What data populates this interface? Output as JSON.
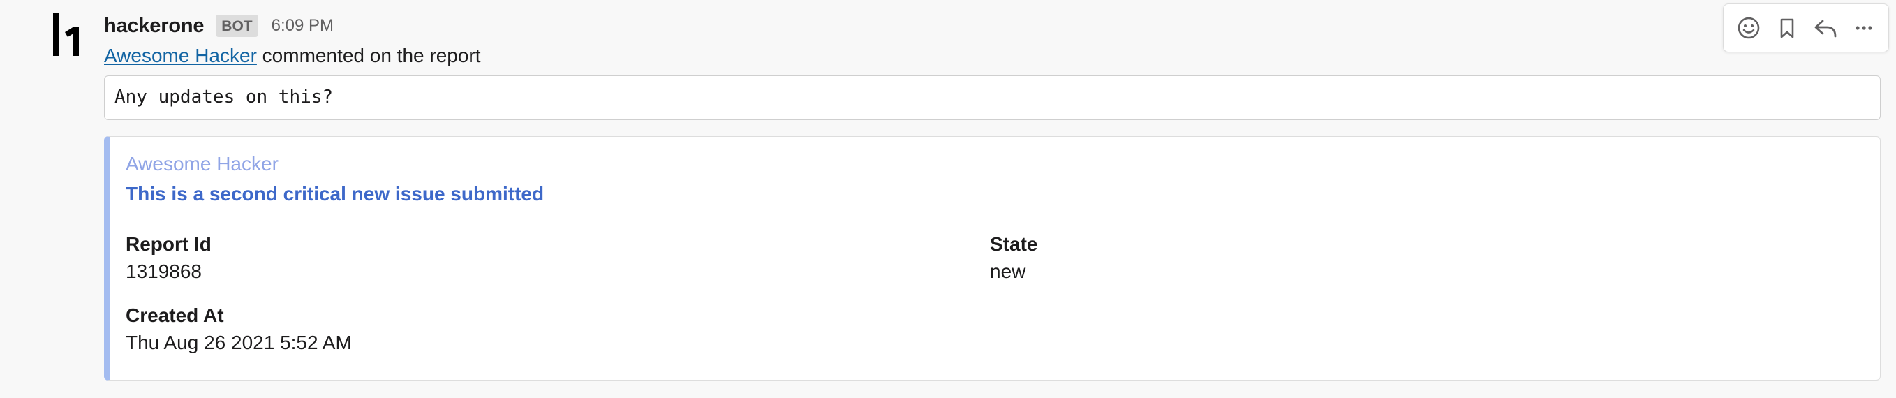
{
  "message": {
    "sender": "hackerone",
    "badge": "BOT",
    "time": "6:09 PM",
    "actor_link": "Awesome Hacker",
    "action_text": " commented on the report",
    "comment": "Any updates on this?"
  },
  "attachment": {
    "author": "Awesome Hacker",
    "title": "This is a second critical new issue submitted",
    "accent_color": "#a4bcf0",
    "fields": {
      "report_id_label": "Report Id",
      "report_id_value": "1319868",
      "state_label": "State",
      "state_value": "new",
      "created_label": "Created At",
      "created_value": "Thu Aug 26 2021 5:52 AM"
    }
  },
  "toolbar": {
    "icons": [
      "emoji-icon",
      "bookmark-icon",
      "reply-icon",
      "more-icon"
    ]
  }
}
